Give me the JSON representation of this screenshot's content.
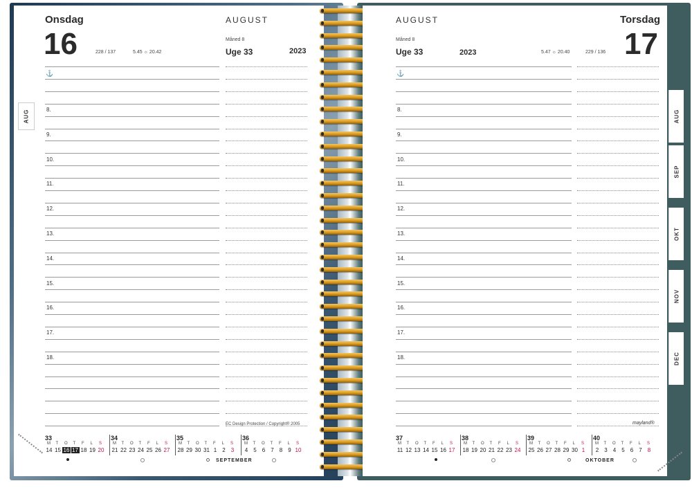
{
  "left_page": {
    "day_name": "Onsdag",
    "day_number": "16",
    "day_count": "228 / 137",
    "sun_times": "5.45 ☼ 20.42",
    "month_name": "AUGUST",
    "month_number": "Måned 8",
    "week_label": "Uge 33",
    "year": "2023",
    "hours": [
      "8.",
      "9.",
      "10.",
      "11.",
      "12.",
      "13.",
      "14.",
      "15.",
      "16.",
      "17.",
      "18."
    ],
    "copyright": "EC Design Protection / Copyright® 2005",
    "next_month": "SEPTEMBER"
  },
  "right_page": {
    "day_name": "Torsdag",
    "day_number": "17",
    "day_count": "229 / 136",
    "sun_times": "5.47 ☼ 20.40",
    "month_name": "AUGUST",
    "month_number": "Måned 8",
    "week_label": "Uge 33",
    "year": "2023",
    "hours": [
      "8.",
      "9.",
      "10.",
      "11.",
      "12.",
      "13.",
      "14.",
      "15.",
      "16.",
      "17.",
      "18."
    ],
    "brand": "mayland®",
    "next_month": "OKTOBER"
  },
  "weekday_letters": [
    "M",
    "T",
    "O",
    "T",
    "F",
    "L",
    "S"
  ],
  "left_calendar": [
    {
      "week": "33",
      "days": [
        "14",
        "15",
        "16",
        "17",
        "18",
        "19",
        "20"
      ]
    },
    {
      "week": "34",
      "days": [
        "21",
        "22",
        "23",
        "24",
        "25",
        "26",
        "27"
      ]
    },
    {
      "week": "35",
      "days": [
        "28",
        "29",
        "30",
        "31",
        "1",
        "2",
        "3"
      ]
    },
    {
      "week": "36",
      "days": [
        "4",
        "5",
        "6",
        "7",
        "8",
        "9",
        "10"
      ]
    }
  ],
  "right_calendar": [
    {
      "week": "37",
      "days": [
        "11",
        "12",
        "13",
        "14",
        "15",
        "16",
        "17"
      ]
    },
    {
      "week": "38",
      "days": [
        "18",
        "19",
        "20",
        "21",
        "22",
        "23",
        "24"
      ]
    },
    {
      "week": "39",
      "days": [
        "25",
        "26",
        "27",
        "28",
        "29",
        "30",
        "1"
      ]
    },
    {
      "week": "40",
      "days": [
        "2",
        "3",
        "4",
        "5",
        "6",
        "7",
        "8"
      ]
    }
  ],
  "month_tabs_left": [
    "AUG"
  ],
  "month_tabs_right": [
    "AUG",
    "SEP",
    "OKT",
    "NOV",
    "DEC"
  ],
  "colors": {
    "sunday": "#c0134a",
    "ring_gold": "#d99a1e",
    "cover_right": "#3f5d5e"
  }
}
